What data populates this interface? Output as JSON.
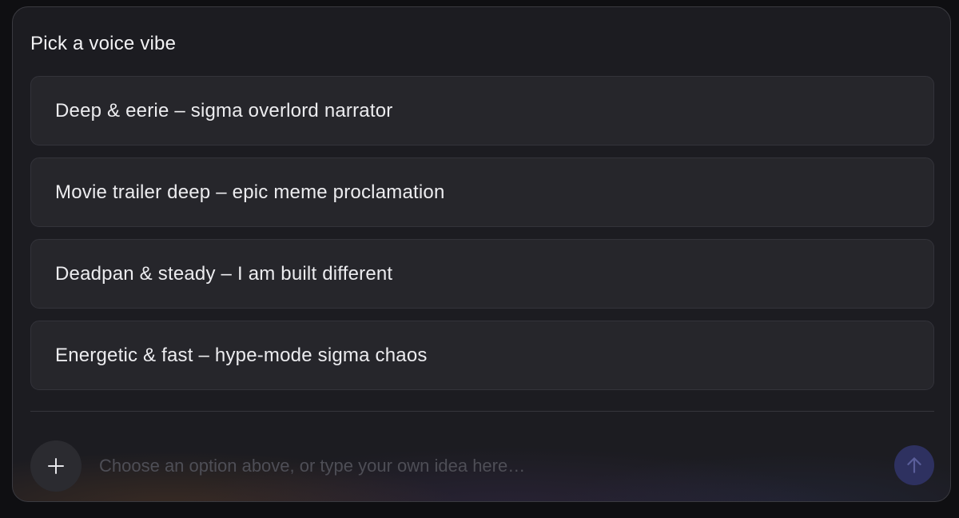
{
  "prompt": {
    "title": "Pick a voice vibe"
  },
  "options": [
    {
      "label": "Deep & eerie – sigma overlord narrator"
    },
    {
      "label": "Movie trailer deep – epic meme proclamation"
    },
    {
      "label": "Deadpan & steady – I am built different"
    },
    {
      "label": "Energetic & fast – hype-mode sigma chaos"
    }
  ],
  "composer": {
    "placeholder": "Choose an option above, or type your own idea here…",
    "add_icon": "plus-icon",
    "send_icon": "arrow-up-icon"
  },
  "colors": {
    "panel_bg": "#1c1c21",
    "option_bg": "#26262b",
    "send_button_bg": "#2e3160"
  }
}
